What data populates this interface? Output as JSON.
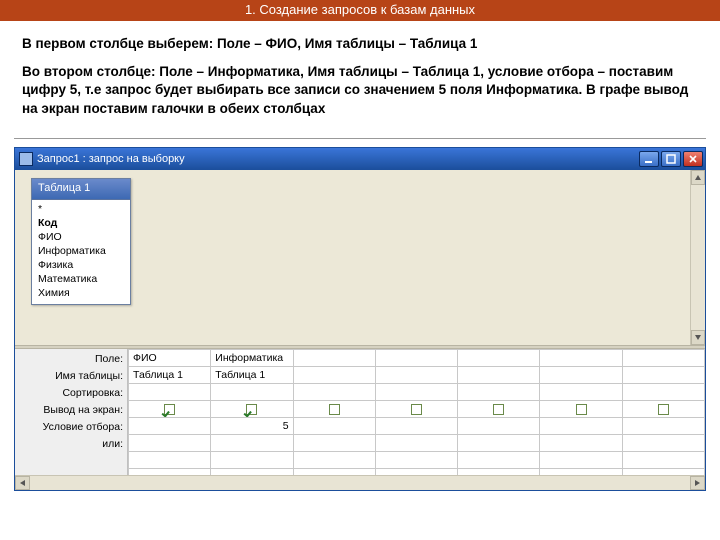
{
  "slide": {
    "title": "1. Создание запросов к базам данных",
    "paragraph1": "В первом столбце выберем: Поле – ФИО, Имя таблицы – Таблица 1",
    "paragraph2": "Во втором столбце: Поле – Информатика, Имя таблицы – Таблица 1, условие отбора – поставим цифру 5, т.е запрос будет выбирать все записи со значением 5 поля Информатика. В графе вывод на экран поставим галочки в обеих столбцах"
  },
  "window": {
    "title": "Запрос1 : запрос на выборку",
    "table_header": "Таблица 1",
    "fields": [
      "*",
      "Код",
      "ФИО",
      "Информатика",
      "Физика",
      "Математика",
      "Химия"
    ]
  },
  "grid": {
    "row_labels": [
      "Поле:",
      "Имя таблицы:",
      "Сортировка:",
      "Вывод на экран:",
      "Условие отбора:",
      "или:"
    ],
    "columns": [
      {
        "field": "ФИО",
        "table": "Таблица 1",
        "sort": "",
        "show": true,
        "criteria": ""
      },
      {
        "field": "Информатика",
        "table": "Таблица 1",
        "sort": "",
        "show": true,
        "criteria": "5"
      },
      {
        "field": "",
        "table": "",
        "sort": "",
        "show": false,
        "criteria": ""
      },
      {
        "field": "",
        "table": "",
        "sort": "",
        "show": false,
        "criteria": ""
      },
      {
        "field": "",
        "table": "",
        "sort": "",
        "show": false,
        "criteria": ""
      },
      {
        "field": "",
        "table": "",
        "sort": "",
        "show": false,
        "criteria": ""
      },
      {
        "field": "",
        "table": "",
        "sort": "",
        "show": false,
        "criteria": ""
      }
    ]
  }
}
